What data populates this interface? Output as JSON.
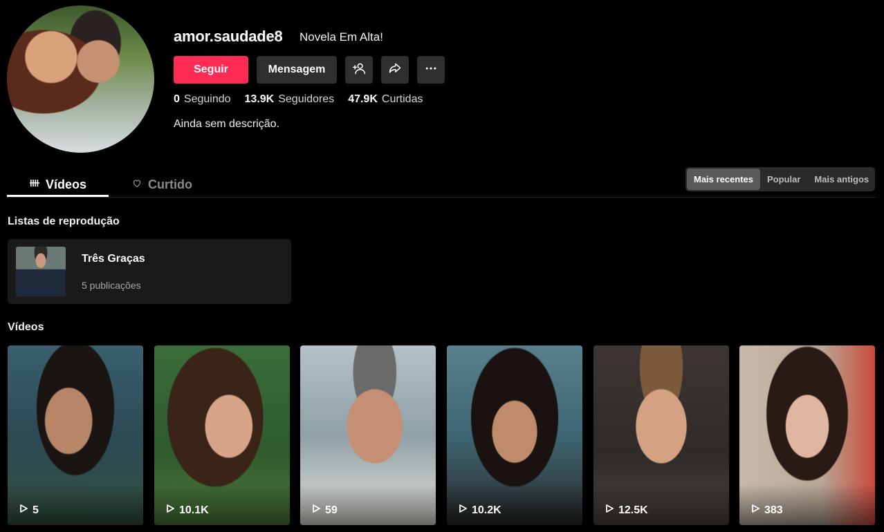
{
  "profile": {
    "username": "amor.saudade8",
    "nickname": "Novela Em Alta!",
    "follow_label": "Seguir",
    "message_label": "Mensagem",
    "stats": [
      {
        "value": "0",
        "label": "Seguindo"
      },
      {
        "value": "13.9K",
        "label": "Seguidores"
      },
      {
        "value": "47.9K",
        "label": "Curtidas"
      }
    ],
    "bio": "Ainda sem descrição."
  },
  "tabs": {
    "videos_label": "Vídeos",
    "liked_label": "Curtido"
  },
  "sort": {
    "options": [
      "Mais recentes",
      "Popular",
      "Mais antigos"
    ],
    "selected": "Mais recentes"
  },
  "playlists": {
    "section_title": "Listas de reprodução",
    "items": [
      {
        "name": "Três Graças",
        "count": "5 publicações"
      }
    ]
  },
  "videos": {
    "section_title": "Vídeos",
    "items": [
      {
        "views": "5"
      },
      {
        "views": "10.1K"
      },
      {
        "views": "59"
      },
      {
        "views": "10.2K"
      },
      {
        "views": "12.5K"
      },
      {
        "views": "383"
      }
    ]
  },
  "colors": {
    "accent": "#fe2c55",
    "button_secondary": "#2f2f2f",
    "background": "#000000"
  }
}
